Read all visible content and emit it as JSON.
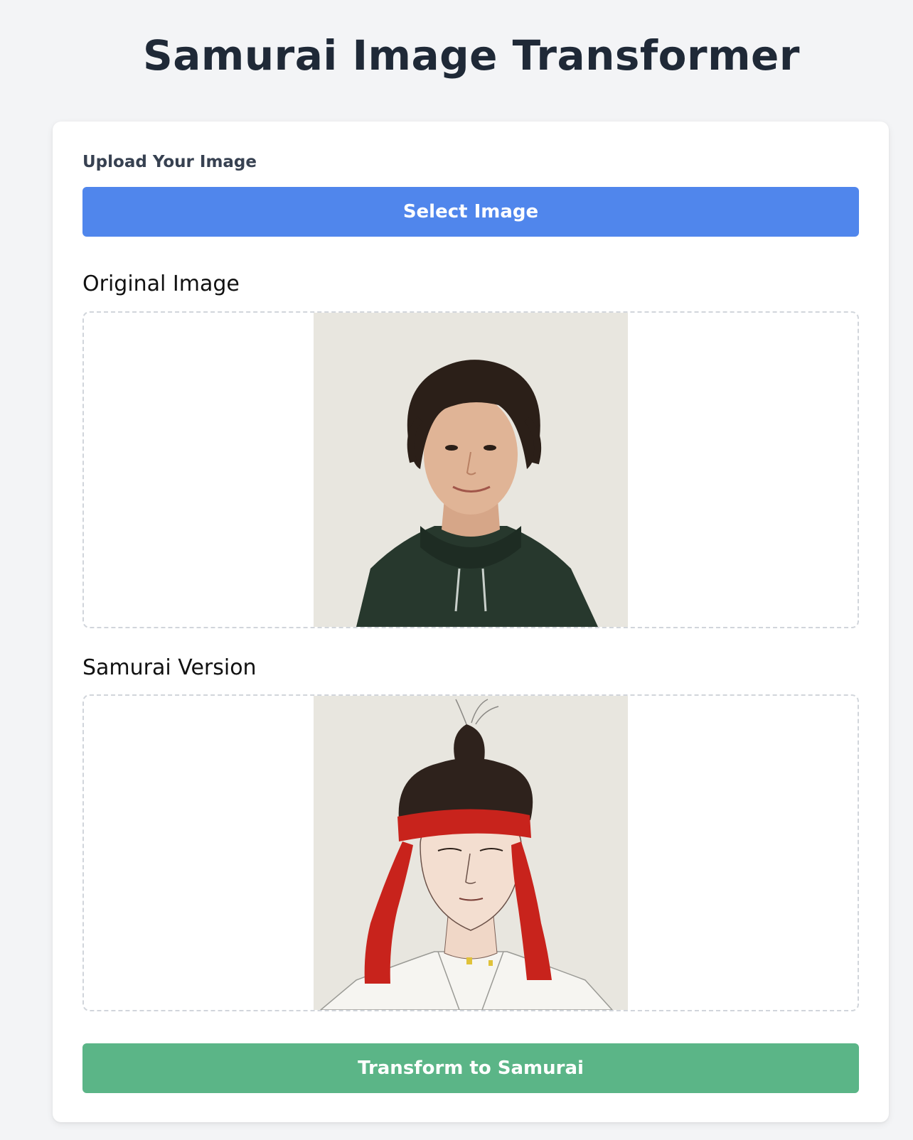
{
  "app": {
    "title": "Samurai Image Transformer"
  },
  "upload": {
    "label": "Upload Your Image",
    "button_label": "Select Image"
  },
  "original": {
    "heading": "Original Image",
    "image_alt": "original-photo"
  },
  "samurai": {
    "heading": "Samurai Version",
    "image_alt": "samurai-illustration"
  },
  "actions": {
    "transform_label": "Transform to Samurai"
  },
  "colors": {
    "page_bg": "#f3f4f6",
    "card_bg": "#ffffff",
    "select_button": "#5086ec",
    "transform_button": "#5bb587",
    "title_text": "#1f2937",
    "headband_red": "#c8231c"
  }
}
